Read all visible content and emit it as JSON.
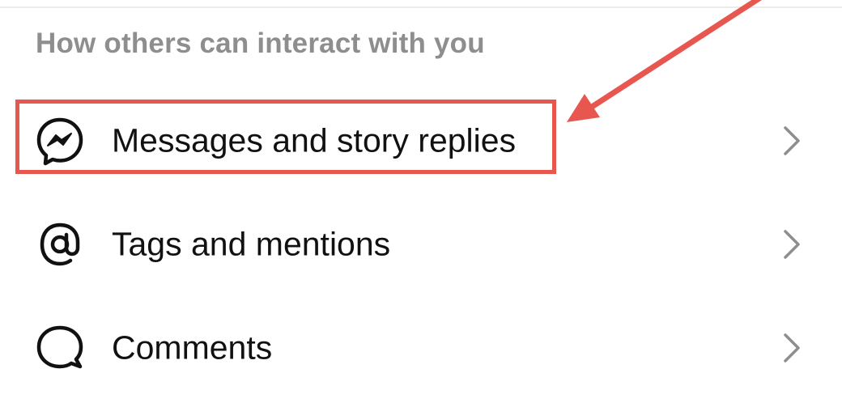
{
  "section": {
    "header": "How others can interact with you"
  },
  "items": [
    {
      "label": "Messages and story replies",
      "icon": "messenger-icon"
    },
    {
      "label": "Tags and mentions",
      "icon": "at-sign-icon"
    },
    {
      "label": "Comments",
      "icon": "comment-bubble-icon"
    }
  ],
  "colors": {
    "annotation": "#e8574f",
    "header_text": "#8e8e8e",
    "item_text": "#111111",
    "chevron": "#8e8e8e"
  }
}
